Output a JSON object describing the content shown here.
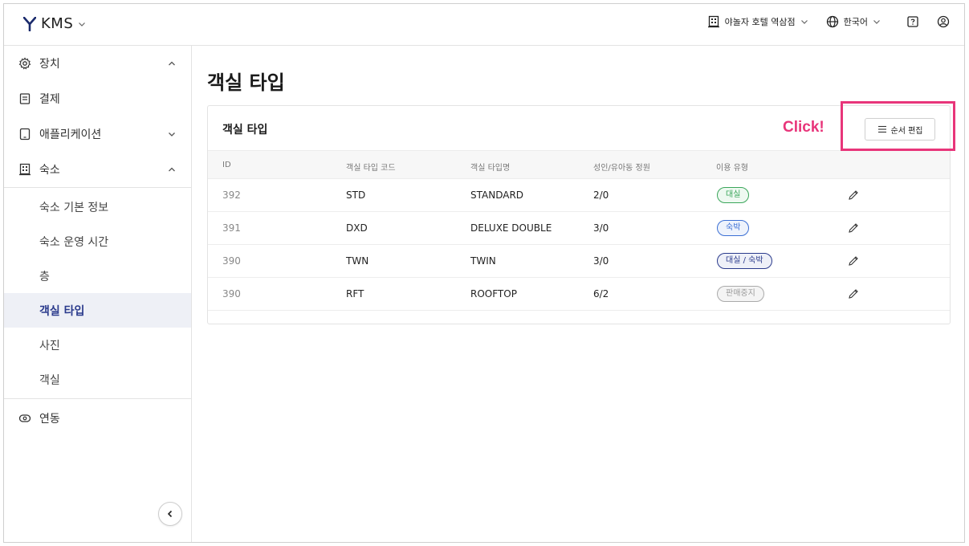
{
  "app": {
    "name": "KMS"
  },
  "header": {
    "property": "야놀자 호텔 역삼점",
    "language": "한국어"
  },
  "sidebar": {
    "items": [
      {
        "label": "장치",
        "icon": "gear-icon",
        "caret": "up"
      },
      {
        "label": "결제",
        "icon": "receipt-icon"
      },
      {
        "label": "애플리케이션",
        "icon": "tablet-icon",
        "caret": "down"
      },
      {
        "label": "숙소",
        "icon": "building-icon",
        "caret": "up"
      }
    ],
    "sub_items": [
      {
        "label": "숙소 기본 정보"
      },
      {
        "label": "숙소 운영 시간"
      },
      {
        "label": "층"
      },
      {
        "label": "객실 타입",
        "active": true
      },
      {
        "label": "사진"
      },
      {
        "label": "객실"
      }
    ],
    "bottom_item": {
      "label": "연동",
      "icon": "link-toggle-icon"
    }
  },
  "main": {
    "title": "객실 타입",
    "card_title": "객실 타입",
    "annotation": "Click!",
    "order_button": "순서 편집",
    "columns": [
      "ID",
      "객실 타입 코드",
      "객실 타입명",
      "성인/유아동 정원",
      "이용 유형"
    ],
    "rows": [
      {
        "id": "392",
        "code": "STD",
        "name": "STANDARD",
        "capacity": "2/0",
        "usage": "대실"
      },
      {
        "id": "391",
        "code": "DXD",
        "name": "DELUXE DOUBLE",
        "capacity": "3/0",
        "usage": "숙박"
      },
      {
        "id": "390",
        "code": "TWN",
        "name": "TWIN",
        "capacity": "3/0",
        "usage": "대실 / 숙박"
      },
      {
        "id": "390",
        "code": "RFT",
        "name": "ROOFTOP",
        "capacity": "6/2",
        "usage": "판매중지"
      }
    ]
  },
  "colors": {
    "accent": "#2a3a8c",
    "highlight": "#e8357a",
    "badge_daesil": "#3aa65a",
    "badge_sukbak": "#3b6fd4",
    "badge_both": "#2a3a8c",
    "badge_stopped": "#9a9a9a"
  }
}
